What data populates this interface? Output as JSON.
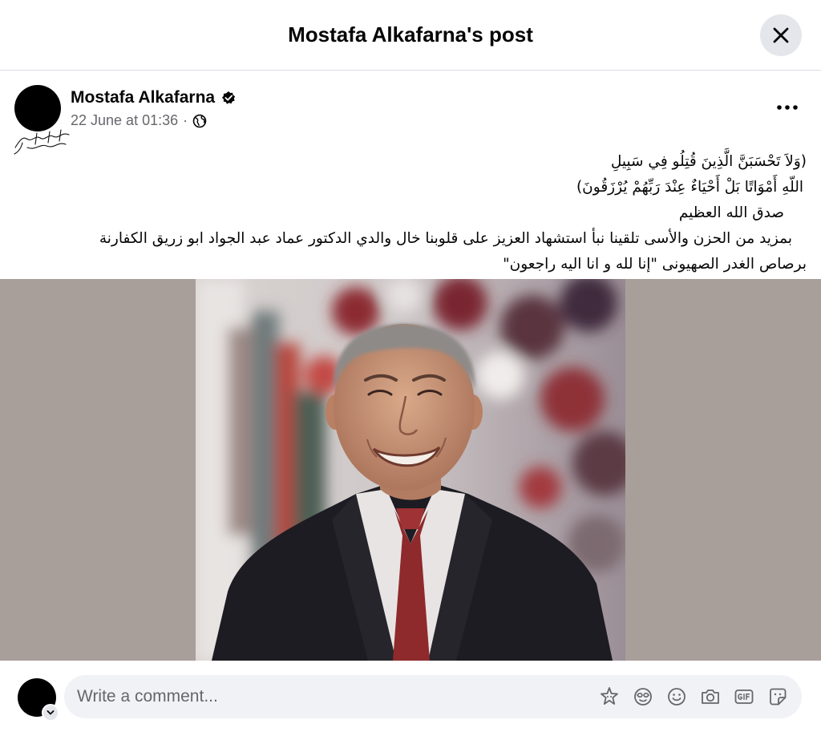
{
  "modal": {
    "title": "Mostafa Alkafarna's post",
    "close_icon": "close-icon"
  },
  "post": {
    "author": "Mostafa Alkafarna",
    "verified_icon": "verified-badge-icon",
    "timestamp": "22 June at 01:36",
    "meta_separator": "·",
    "audience_icon": "globe-icon",
    "more_icon": "more-options-icon",
    "avatar_calligraphy": "بسم الله الرحمن الرحيم",
    "text_lines": [
      "(وَلاَ تَحْسَبَنَّ الَّذِينَ قُتِلُو فِي سَبِيلِ",
      "اللّهِ أَمْوَاتًا بَلْ أَحْيَاءٌ عِنْدَ رَبِّهُمْ يُرْزَقُونَ)",
      "صدق الله العظيم",
      "بمزيد من الحزن والأسى تلقينا نبأ استشهاد العزيز على قلوبنا خال والدي الدكتور عماد عبد الجواد ابو زريق الكفارنة",
      "برصاص الغدر الصهيونى  \"إنا لله و انا اليه راجعون\""
    ],
    "photo": {
      "background_color": "#a99f9a",
      "subject": "portrait-photo"
    }
  },
  "composer": {
    "placeholder": "Write a comment...",
    "caret_icon": "chevron-down-icon",
    "tools": [
      "avatar-sticker-icon",
      "gif-mask-icon",
      "emoji-icon",
      "camera-icon",
      "gif-icon",
      "sticker-icon"
    ]
  }
}
